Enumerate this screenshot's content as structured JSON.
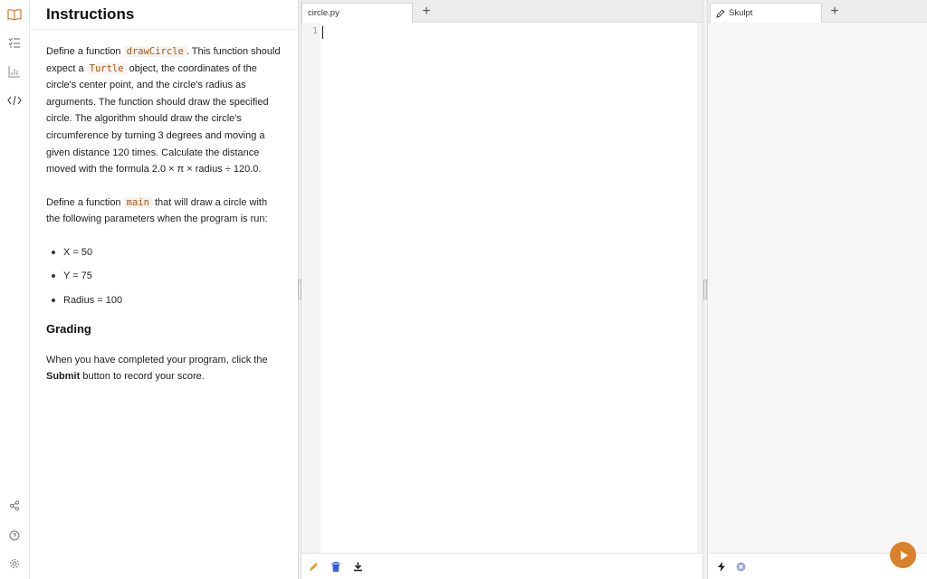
{
  "instructions": {
    "title": "Instructions",
    "p1": {
      "t1": "Define a function ",
      "c1": "drawCircle",
      "t2": ". This function should expect a ",
      "c2": "Turtle",
      "t3": " object, the coordinates of the circle's center point, and the circle's radius as arguments. The function should draw the specified circle. The algorithm should draw the circle's circumference by turning 3 degrees and moving a given distance 120 times. Calculate the distance moved with the formula 2.0 × π × radius ÷ 120.0."
    },
    "p2": {
      "t1": "Define a function ",
      "c1": "main",
      "t2": " that will draw a circle with the following parameters when the program is run:"
    },
    "params": [
      "X = 50",
      "Y = 75",
      "Radius = 100"
    ],
    "grading_title": "Grading",
    "grading": {
      "t1": "When you have completed your program, click the ",
      "b1": "Submit",
      "t2": " button to record your score."
    }
  },
  "editor": {
    "tab_label": "circle.py",
    "add_tab": "+",
    "line_number": "1"
  },
  "output": {
    "tab_label": "Skulpt",
    "add_tab": "+"
  },
  "colors": {
    "accent": "#d9822b",
    "code_text": "#a8591a",
    "trash": "#3b5bdb"
  }
}
